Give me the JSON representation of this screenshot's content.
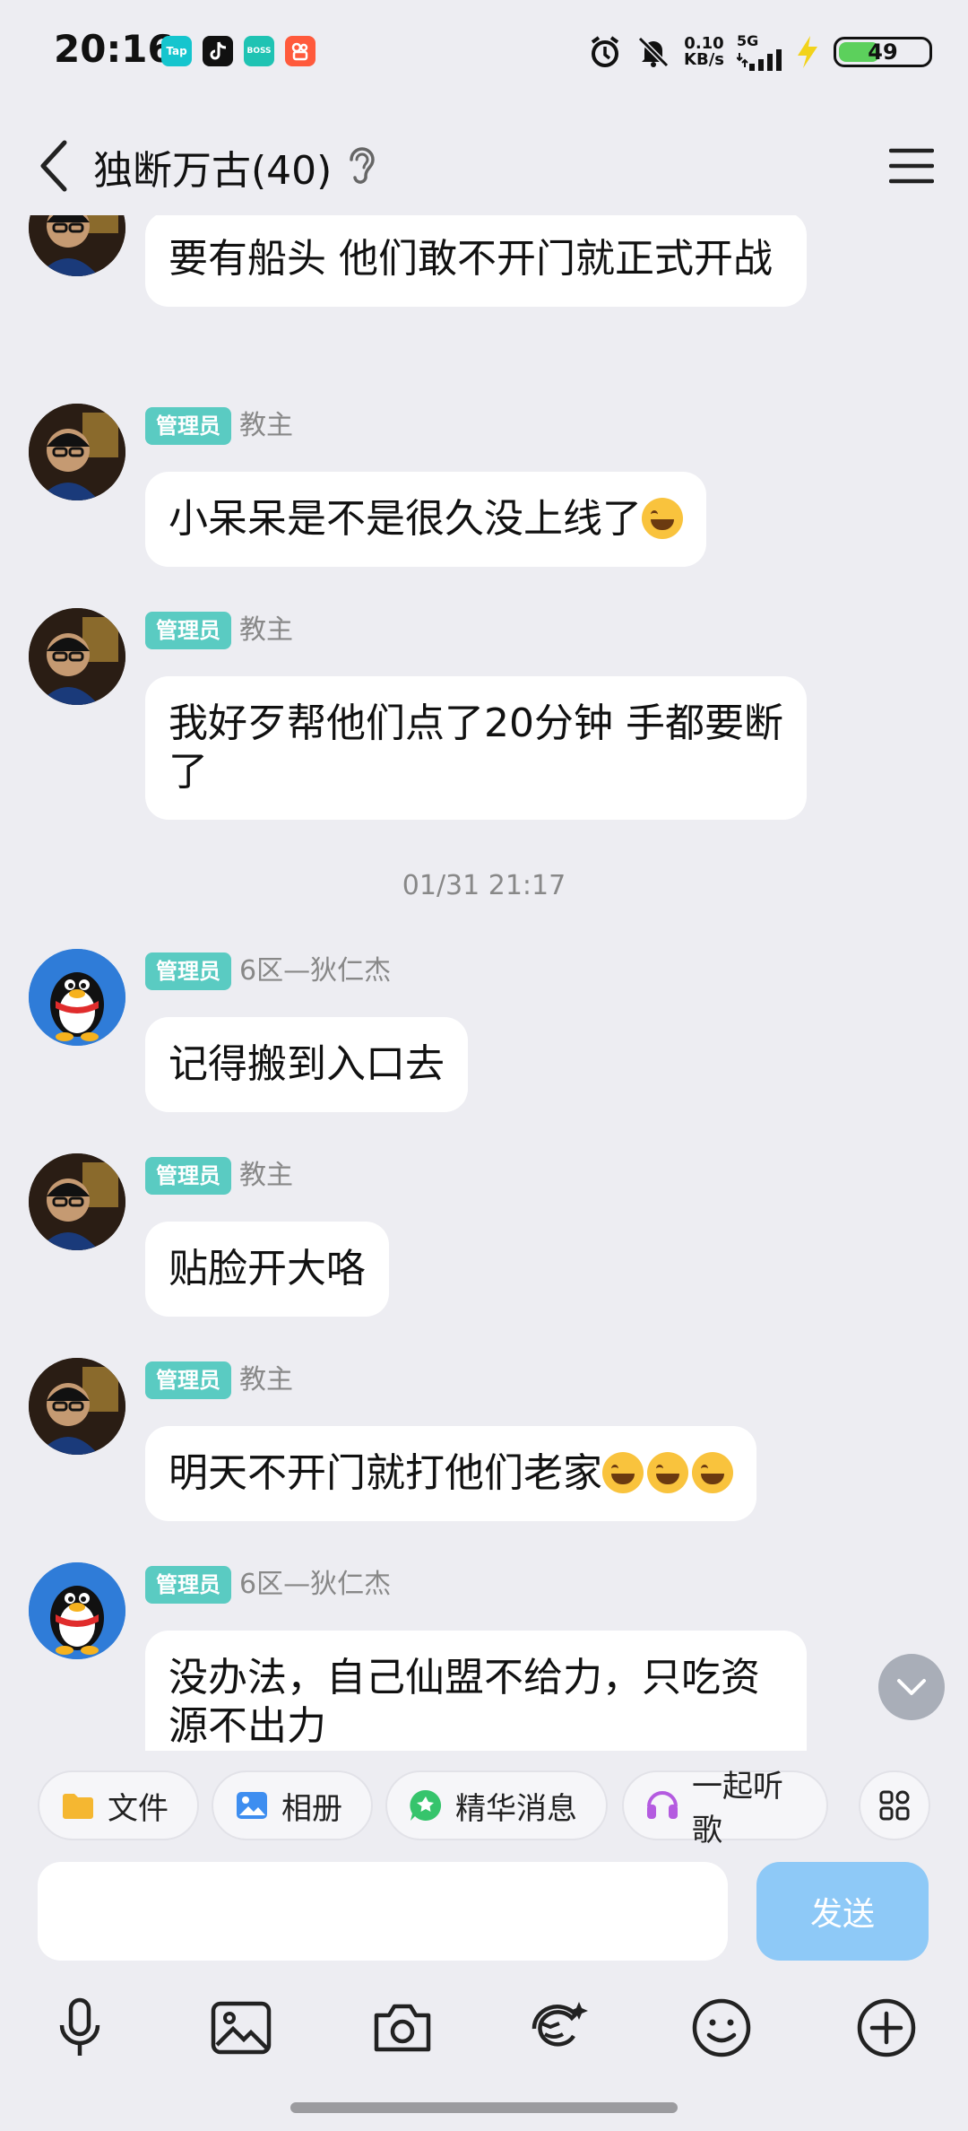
{
  "status_bar": {
    "time": "20:16",
    "app_icons": [
      {
        "icon": "taptap-icon",
        "label": "Tap",
        "color": "#15C5CE"
      },
      {
        "icon": "tiktok-icon",
        "label": "",
        "color": "#111111"
      },
      {
        "icon": "boss-icon",
        "label": "BOSS",
        "color": "#1FC3B3"
      },
      {
        "icon": "kuaishou-icon",
        "label": "",
        "color": "#FF5A3C"
      }
    ],
    "net_speed_value": "0.10",
    "net_speed_unit": "KB/s",
    "network": "5G",
    "battery": "49",
    "battery_level": 0.49
  },
  "header": {
    "title": "独断万古(40)"
  },
  "messages": [
    {
      "role": "",
      "sender": "",
      "text": "要有船头 他们敢不开门就正式开战",
      "avatar": "person"
    },
    {
      "role": "管理员",
      "sender": "教主",
      "text": "小呆呆是不是很久没上线了",
      "emoji_count": 1,
      "avatar": "person"
    },
    {
      "role": "管理员",
      "sender": "教主",
      "text": "我好歹帮他们点了20分钟 手都要断了",
      "avatar": "person"
    },
    {
      "timestamp": "01/31 21:17"
    },
    {
      "role": "管理员",
      "sender": "6区—狄仁杰",
      "text": "记得搬到入口去",
      "avatar": "qq"
    },
    {
      "role": "管理员",
      "sender": "教主",
      "text": "贴脸开大咯",
      "avatar": "person"
    },
    {
      "role": "管理员",
      "sender": "教主",
      "text": "明天不开门就打他们老家",
      "emoji_count": 3,
      "avatar": "person"
    },
    {
      "role": "管理员",
      "sender": "6区—狄仁杰",
      "text": "没办法，自己仙盟不给力，只吃资源不出力",
      "avatar": "qq"
    }
  ],
  "chips": [
    {
      "label": "文件",
      "icon": "folder-icon",
      "color": "#F5B731"
    },
    {
      "label": "相册",
      "icon": "photo-icon",
      "color": "#3E8EF0"
    },
    {
      "label": "精华消息",
      "icon": "star-icon",
      "color": "#36C46C"
    },
    {
      "label": "一起听歌",
      "icon": "headphones-icon",
      "color": "#B45BE0"
    }
  ],
  "input": {
    "placeholder": "",
    "send_label": "发送"
  },
  "toolbar": [
    "mic-icon",
    "image-icon",
    "camera-icon",
    "red-packet-icon",
    "emoji-icon",
    "plus-icon"
  ]
}
